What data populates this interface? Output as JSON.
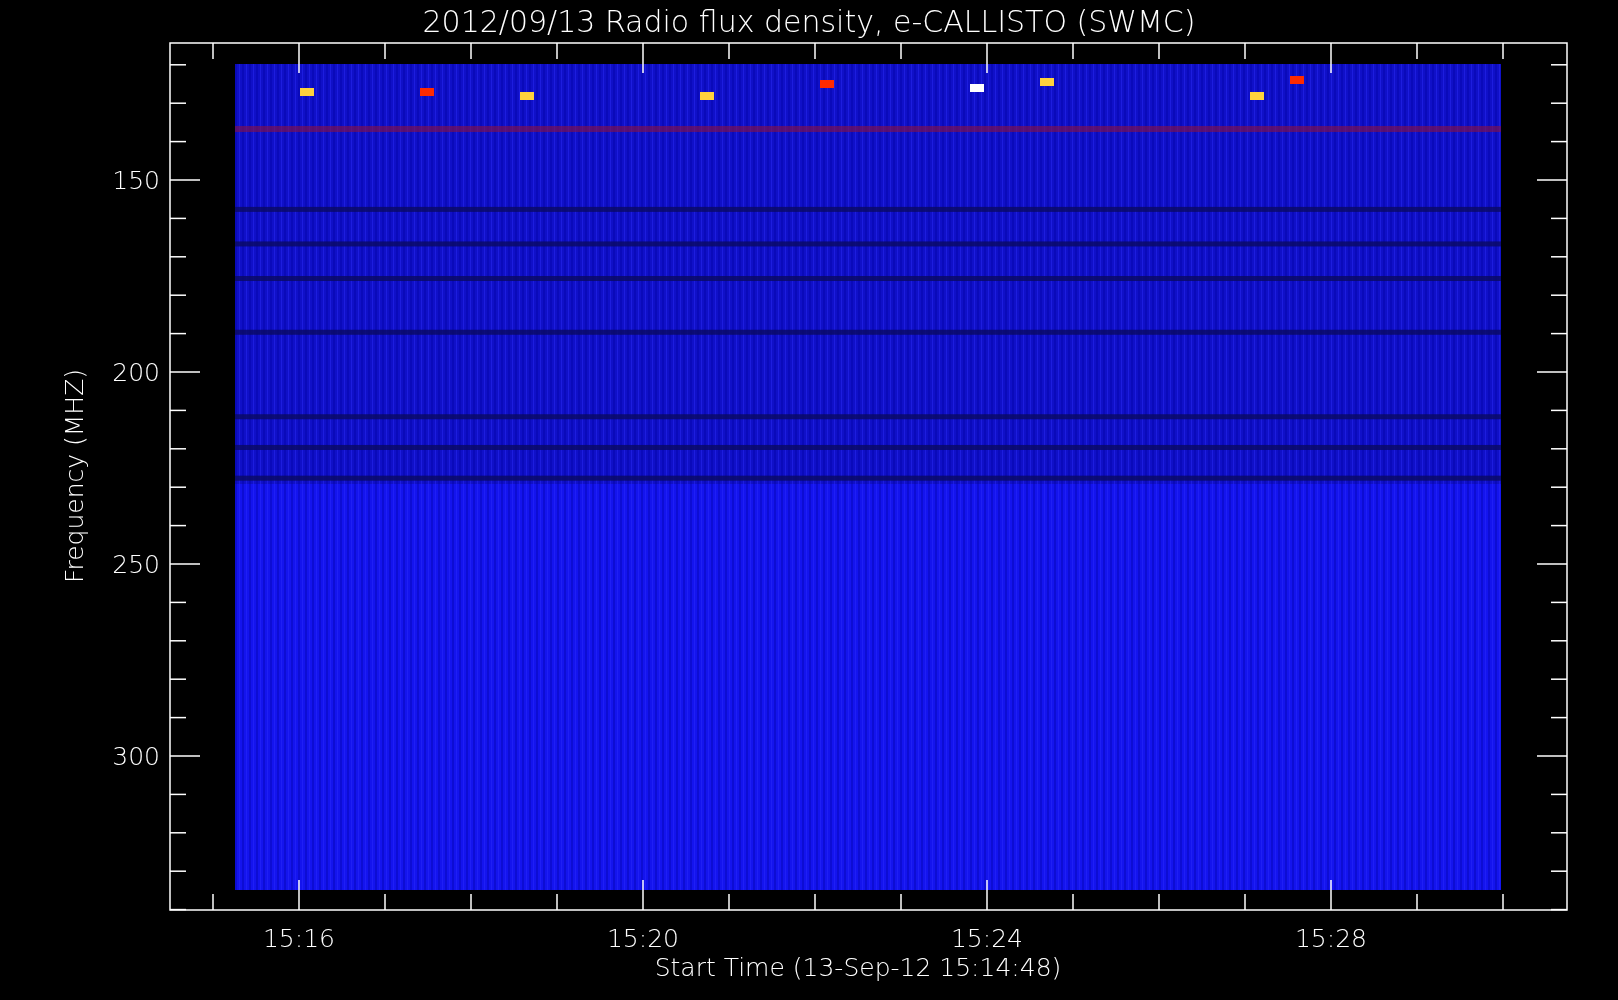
{
  "title": "2012/09/13  Radio flux density, e-CALLISTO (SWMC)",
  "y_axis": {
    "label": "Frequency (MHZ)",
    "ticks": [
      "150",
      "200",
      "250",
      "300"
    ]
  },
  "x_axis": {
    "label": "Start Time (13-Sep-12 15:14:48)",
    "ticks": [
      "15:16",
      "15:20",
      "15:24",
      "15:28"
    ]
  }
}
